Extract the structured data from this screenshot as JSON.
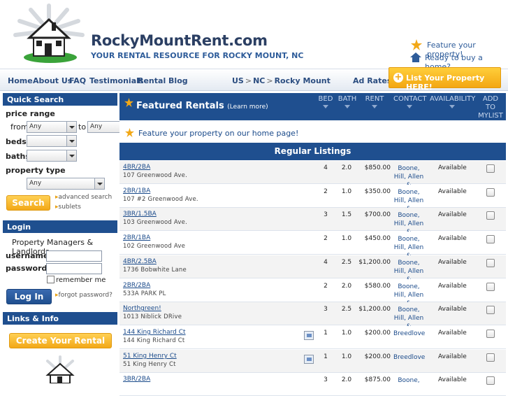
{
  "header": {
    "site_title": "RockyMountRent.com",
    "tagline": "YOUR RENTAL RESOURCE FOR ROCKY MOUNT, NC",
    "feature_link": "Feature your property!",
    "ready_link": "Ready to buy a home?",
    "list_button": "List Your Property HERE!"
  },
  "nav": {
    "items": [
      "Home",
      "About Us",
      "FAQ",
      "Testimonials",
      "Rental Blog"
    ],
    "breadcrumb": [
      "US",
      "NC",
      "Rocky Mount"
    ],
    "ad_rates": "Ad Rates"
  },
  "sidebar": {
    "quick_search": "Quick Search",
    "price_range": "price range",
    "from": "from",
    "to": "to",
    "from_value": "Any",
    "to_value": "Any",
    "beds": "beds",
    "baths": "baths",
    "property_type": "property type",
    "property_type_value": "Any",
    "search_button": "Search",
    "advanced_search": "advanced search",
    "sublets": "sublets",
    "login_head": "Login",
    "login_sub": "Property Managers & Landlords",
    "username": "username",
    "password": "password",
    "remember_me": "remember me",
    "login_button": "Log In",
    "forgot_password": "forgot password?",
    "links_head": "Links & Info",
    "create_ad": "Create Your Rental Ad!"
  },
  "featured": {
    "title": "Featured Rentals",
    "learn_more": "(Learn more)",
    "columns": [
      "BED",
      "BATH",
      "RENT",
      "CONTACT",
      "AVAILABILITY",
      "ADD TO MYLIST"
    ],
    "strip_text": "Feature your property on our home page!"
  },
  "regular": {
    "title": "Regular Listings",
    "rows": [
      {
        "title": "4BR/2BA",
        "addr": "107 Greenwood Ave.",
        "bed": "4",
        "bath": "2.0",
        "rent": "$850.00",
        "contact": "Boone, Hill, Allen &",
        "avail": "Available"
      },
      {
        "title": "2BR/1BA",
        "addr": "107 #2 Greenwood Ave.",
        "bed": "2",
        "bath": "1.0",
        "rent": "$350.00",
        "contact": "Boone, Hill, Allen &",
        "avail": "Available"
      },
      {
        "title": "3BR/1.5BA",
        "addr": "103 Greenwood Ave.",
        "bed": "3",
        "bath": "1.5",
        "rent": "$700.00",
        "contact": "Boone, Hill, Allen &",
        "avail": "Available"
      },
      {
        "title": "2BR/1BA",
        "addr": "102 Greenwood Ave",
        "bed": "2",
        "bath": "1.0",
        "rent": "$450.00",
        "contact": "Boone, Hill, Allen &",
        "avail": "Available"
      },
      {
        "title": "4BR/2.5BA",
        "addr": "1736 Bobwhite Lane",
        "bed": "4",
        "bath": "2.5",
        "rent": "$1,200.00",
        "contact": "Boone, Hill, Allen &",
        "avail": "Available"
      },
      {
        "title": "2BR/2BA",
        "addr": "533A PARK PL",
        "bed": "2",
        "bath": "2.0",
        "rent": "$580.00",
        "contact": "Boone, Hill, Allen &",
        "avail": "Available"
      },
      {
        "title": "Northgreen!",
        "addr": "1013 Niblick DRive",
        "bed": "3",
        "bath": "2.5",
        "rent": "$1,200.00",
        "contact": "Boone, Hill, Allen &",
        "avail": "Available"
      },
      {
        "title": "144 King Richard Ct",
        "addr": "144 King Richard Ct",
        "bed": "1",
        "bath": "1.0",
        "rent": "$200.00",
        "contact": "Breedlove",
        "avail": "Available",
        "photo": true
      },
      {
        "title": "51 King Henry Ct",
        "addr": "51 King Henry Ct",
        "bed": "1",
        "bath": "1.0",
        "rent": "$200.00",
        "contact": "Breedlove",
        "avail": "Available",
        "photo": true
      },
      {
        "title": "3BR/2BA",
        "addr": "",
        "bed": "3",
        "bath": "2.0",
        "rent": "$875.00",
        "contact": "Boone,",
        "avail": "Available"
      }
    ]
  },
  "colors": {
    "navy": "#1f4f8f",
    "orange": "#f2a817",
    "link": "#1a4a8a"
  }
}
